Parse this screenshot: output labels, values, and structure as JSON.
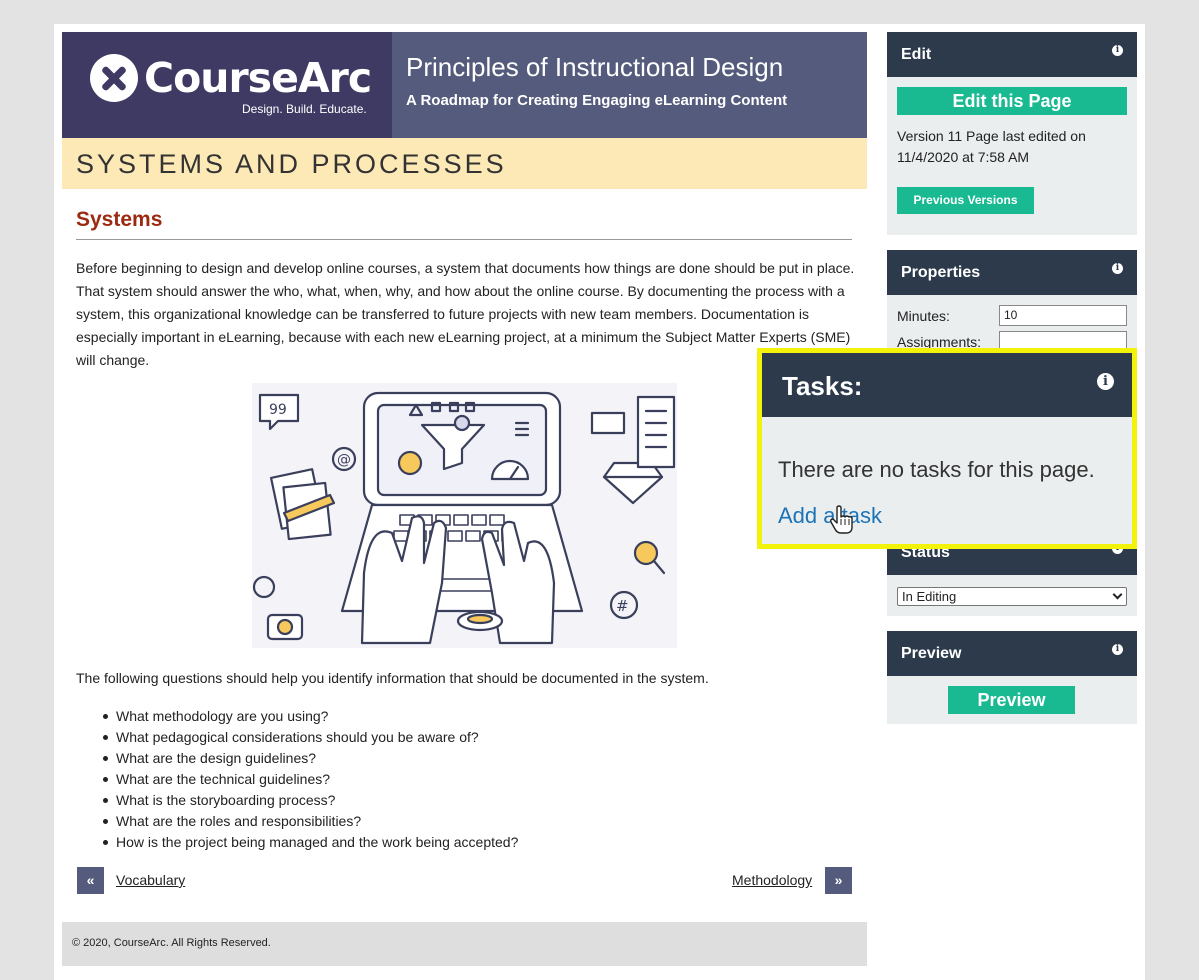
{
  "header": {
    "logo_text": "CourseArc",
    "logo_tagline": "Design. Build. Educate.",
    "course_title": "Principles of Instructional Design",
    "course_subtitle": "A Roadmap for Creating Engaging eLearning Content"
  },
  "section_title": "SYSTEMS AND PROCESSES",
  "content": {
    "heading": "Systems",
    "paragraph": "Before beginning to design and develop online courses, a system that documents how things are done should be put in place. That system should answer the who, what, when, why, and how about the online course. By documenting the process with a system, this organizational knowledge can be transferred to future projects with new team members. Documentation is especially important in eLearning, because with each new eLearning project, at a minimum the Subject Matter Experts (SME) will change.",
    "intro_questions": "The following questions should help you identify information that should be documented in the system.",
    "questions": [
      "What methodology are you using?",
      "What pedagogical considerations should you be aware of?",
      "What are the design guidelines?",
      "What are the technical guidelines?",
      "What is the storyboarding process?",
      "What are the roles and responsibilities?",
      "How is the project being managed and the work being accepted?"
    ]
  },
  "nav": {
    "prev_symbol": "«",
    "prev_label": "Vocabulary",
    "next_symbol": "»",
    "next_label": "Methodology"
  },
  "footer": "© 2020, CourseArc. All Rights Reserved.",
  "sidebar": {
    "edit": {
      "title": "Edit",
      "edit_button": "Edit this Page",
      "version_info": "Version 11   Page last edited on 11/4/2020 at 7:58 AM",
      "previous_versions_button": "Previous Versions"
    },
    "properties": {
      "title": "Properties",
      "minutes_label": "Minutes:",
      "minutes_value": "10",
      "assignments_label": "Assignments:",
      "assignments_value": ""
    },
    "status": {
      "title": "Status",
      "selected": "In Editing"
    },
    "preview": {
      "title": "Preview",
      "button": "Preview"
    }
  },
  "tasks": {
    "title": "Tasks:",
    "empty_message": "There are no tasks for this page.",
    "add_link": "Add a task"
  },
  "icons": {
    "info": "info-icon",
    "cursor": "hand-pointer-icon",
    "logo": "tools-logo-icon"
  },
  "colors": {
    "banner": "#555b7c",
    "logo_bg": "#3e3a63",
    "section_bar": "#fde9b6",
    "heading": "#9c2a12",
    "panel_head": "#2c3a4b",
    "button_green": "#19b991",
    "highlight": "#f2f20a",
    "link": "#1c73b8"
  }
}
